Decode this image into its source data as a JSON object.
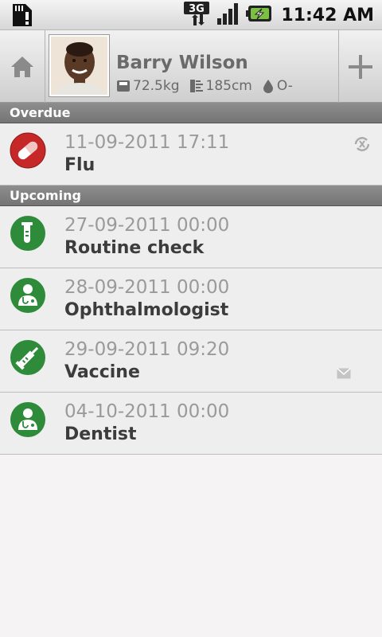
{
  "status_bar": {
    "time": "11:42 AM",
    "network": "3G",
    "icons": [
      "sd-card-icon",
      "signal-3g-icon",
      "signal-strength-icon",
      "battery-charging-icon"
    ]
  },
  "header": {
    "name": "Barry Wilson",
    "weight": "72.5kg",
    "height": "185cm",
    "blood_type": "O-",
    "home_icon": "home-icon",
    "add_icon": "plus-icon"
  },
  "sections": {
    "overdue": "Overdue",
    "upcoming": "Upcoming"
  },
  "overdue_items": [
    {
      "date": "11-09-2011 17:11",
      "title": "Flu",
      "icon": "pill-icon",
      "color": "#c62828",
      "badge": "sync-off-icon"
    }
  ],
  "upcoming_items": [
    {
      "date": "27-09-2011 00:00",
      "title": "Routine check",
      "icon": "test-tube-icon",
      "color": "#2e8b3a"
    },
    {
      "date": "28-09-2011 00:00",
      "title": "Ophthalmologist",
      "icon": "doctor-icon",
      "color": "#2e8b3a"
    },
    {
      "date": "29-09-2011 09:20",
      "title": "Vaccine",
      "icon": "syringe-icon",
      "color": "#2e8b3a",
      "badge": "envelope-icon"
    },
    {
      "date": "04-10-2011 00:00",
      "title": "Dentist",
      "icon": "doctor-icon",
      "color": "#2e8b3a"
    }
  ]
}
